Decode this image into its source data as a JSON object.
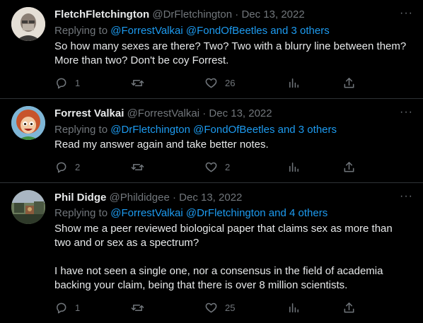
{
  "tweets": [
    {
      "name": "FletchFletchington",
      "handle": "@DrFletchington",
      "sep": "·",
      "date": "Dec 13, 2022",
      "replying_to": "Replying to",
      "mentions": "@ForrestValkai @FondOfBeetles and 3 others",
      "text": [
        "So how many sexes are there? Two? Two with a blurry line between them?",
        "More than two? Don't be coy Forrest."
      ],
      "replies": "1",
      "retweets": "",
      "likes": "26"
    },
    {
      "name": "Forrest Valkai",
      "handle": "@ForrestValkai",
      "sep": "·",
      "date": "Dec 13, 2022",
      "replying_to": "Replying to",
      "mentions": "@DrFletchington @FondOfBeetles and 3 others",
      "text": [
        "Read my answer again and take better notes."
      ],
      "replies": "2",
      "retweets": "",
      "likes": "2"
    },
    {
      "name": "Phil Didge",
      "handle": "@Phildidgee",
      "sep": "·",
      "date": "Dec 13, 2022",
      "replying_to": "Replying to",
      "mentions": "@ForrestValkai @DrFletchington and 4 others",
      "text": [
        "Show me a peer reviewed biological paper that claims sex as more than",
        "two and or sex as a spectrum?",
        "",
        "I have not seen a single one, nor a consensus in the field of academia",
        "backing your claim, being that there is over 8 million scientists."
      ],
      "replies": "1",
      "retweets": "",
      "likes": "25"
    }
  ],
  "more_icon": "···",
  "colors": {
    "bg": "#000000",
    "text": "#e7e9ea",
    "muted": "#71767b",
    "link": "#1d9bf0",
    "divider": "#2f3336"
  }
}
